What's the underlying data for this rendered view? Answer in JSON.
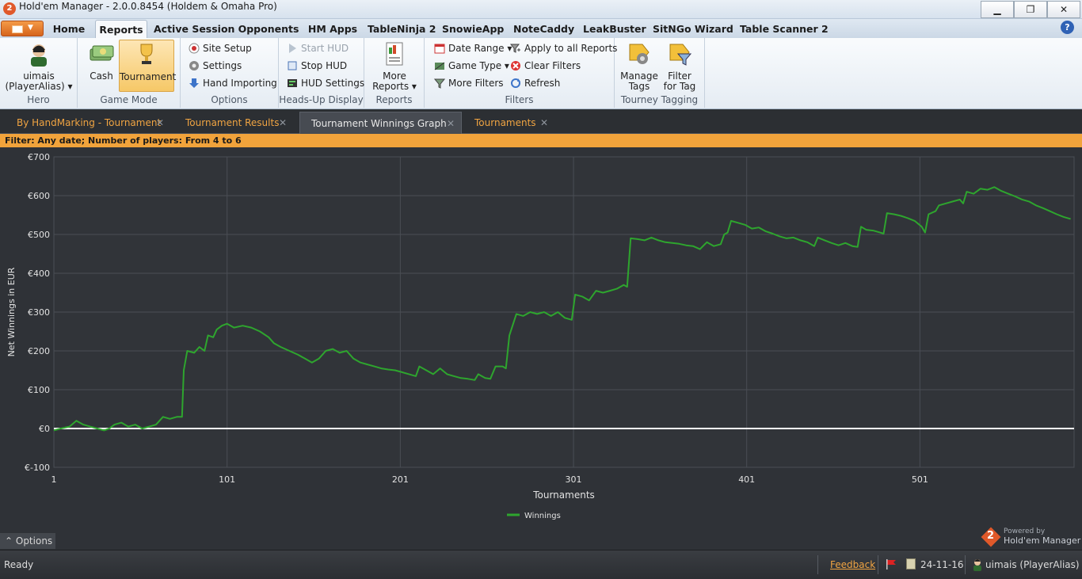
{
  "window": {
    "title": "Hold'em Manager - 2.0.0.8454 (Holdem & Omaha Pro)",
    "app_icon_text": "2",
    "minimize": "▁",
    "restore": "❐",
    "close": "✕"
  },
  "ribbon_tabs": [
    {
      "label": "Home"
    },
    {
      "label": "Reports"
    },
    {
      "label": "Active Session"
    },
    {
      "label": "Opponents"
    },
    {
      "label": "HM Apps"
    },
    {
      "label": "TableNinja 2"
    },
    {
      "label": "SnowieApp"
    },
    {
      "label": "NoteCaddy"
    },
    {
      "label": "LeakBuster"
    },
    {
      "label": "SitNGo Wizard"
    },
    {
      "label": "Table Scanner 2"
    }
  ],
  "help": "?",
  "ribbon": {
    "hero": {
      "label_line1": "uimais",
      "label_line2": "(PlayerAlias) ▾",
      "group": "Hero"
    },
    "game_mode": {
      "cash": "Cash",
      "tournament": "Tournament",
      "group": "Game Mode"
    },
    "options": {
      "site_setup": "Site Setup",
      "settings": "Settings",
      "hand_importing": "Hand Importing",
      "group": "Options"
    },
    "hud": {
      "start_hud": "Start HUD",
      "stop_hud": "Stop HUD",
      "hud_settings": "HUD Settings",
      "group": "Heads-Up Display"
    },
    "reports": {
      "more_line1": "More",
      "more_line2": "Reports ▾",
      "group": "Reports"
    },
    "filters": {
      "date_range": "Date Range ▾",
      "game_type": "Game Type ▾",
      "more_filters": "More Filters",
      "apply_all": "Apply to all Reports",
      "clear_filters": "Clear Filters",
      "refresh": "Refresh",
      "group": "Filters"
    },
    "tagging": {
      "manage_line1": "Manage",
      "manage_line2": "Tags",
      "filter_line1": "Filter",
      "filter_line2": "for Tag",
      "group": "Tourney Tagging"
    }
  },
  "doc_tabs": [
    {
      "label": "By HandMarking - Tournament"
    },
    {
      "label": "Tournament Results"
    },
    {
      "label": "Tournament Winnings Graph"
    },
    {
      "label": "Tournaments"
    }
  ],
  "tab_close": "✕",
  "filter_text": "Filter: Any date; Number of players: From 4 to 6",
  "colors": {
    "line": "#2ea52e",
    "zero_line": "#ffffff",
    "grid": "#4a4e55",
    "axis_text": "#e2e2e2",
    "accent": "#f1a33b"
  },
  "chart_data": {
    "type": "line",
    "ylabel": "Net Winnings in EUR",
    "xlabel": "Tournaments",
    "ylim": [
      -100,
      700
    ],
    "xlim": [
      1,
      590
    ],
    "y_ticks": [
      "€-100",
      "€0",
      "€100",
      "€200",
      "€300",
      "€400",
      "€500",
      "€600",
      "€700"
    ],
    "x_ticks": [
      "1",
      "101",
      "201",
      "301",
      "401",
      "501"
    ],
    "grid": true,
    "legend": "bottom-center",
    "series": [
      {
        "name": "Winnings",
        "points": [
          [
            1,
            -5
          ],
          [
            5,
            0
          ],
          [
            10,
            5
          ],
          [
            14,
            20
          ],
          [
            18,
            10
          ],
          [
            22,
            5
          ],
          [
            26,
            0
          ],
          [
            30,
            -5
          ],
          [
            33,
            0
          ],
          [
            36,
            10
          ],
          [
            40,
            15
          ],
          [
            44,
            5
          ],
          [
            48,
            10
          ],
          [
            52,
            0
          ],
          [
            56,
            5
          ],
          [
            60,
            10
          ],
          [
            64,
            30
          ],
          [
            68,
            25
          ],
          [
            72,
            30
          ],
          [
            75,
            30
          ],
          [
            76,
            150
          ],
          [
            78,
            200
          ],
          [
            82,
            195
          ],
          [
            85,
            210
          ],
          [
            88,
            200
          ],
          [
            90,
            240
          ],
          [
            93,
            235
          ],
          [
            95,
            255
          ],
          [
            98,
            265
          ],
          [
            101,
            270
          ],
          [
            105,
            260
          ],
          [
            110,
            265
          ],
          [
            115,
            260
          ],
          [
            120,
            250
          ],
          [
            125,
            235
          ],
          [
            128,
            220
          ],
          [
            132,
            210
          ],
          [
            137,
            200
          ],
          [
            142,
            190
          ],
          [
            146,
            180
          ],
          [
            150,
            170
          ],
          [
            154,
            180
          ],
          [
            158,
            200
          ],
          [
            162,
            205
          ],
          [
            166,
            195
          ],
          [
            170,
            200
          ],
          [
            174,
            180
          ],
          [
            178,
            170
          ],
          [
            182,
            165
          ],
          [
            186,
            160
          ],
          [
            190,
            155
          ],
          [
            194,
            152
          ],
          [
            198,
            150
          ],
          [
            202,
            145
          ],
          [
            206,
            140
          ],
          [
            210,
            135
          ],
          [
            212,
            160
          ],
          [
            216,
            150
          ],
          [
            220,
            140
          ],
          [
            224,
            155
          ],
          [
            228,
            140
          ],
          [
            232,
            135
          ],
          [
            236,
            130
          ],
          [
            240,
            128
          ],
          [
            244,
            125
          ],
          [
            246,
            140
          ],
          [
            250,
            130
          ],
          [
            253,
            128
          ],
          [
            256,
            160
          ],
          [
            260,
            160
          ],
          [
            262,
            155
          ],
          [
            264,
            240
          ],
          [
            268,
            295
          ],
          [
            272,
            290
          ],
          [
            276,
            300
          ],
          [
            280,
            295
          ],
          [
            284,
            300
          ],
          [
            288,
            290
          ],
          [
            292,
            300
          ],
          [
            296,
            285
          ],
          [
            300,
            280
          ],
          [
            302,
            345
          ],
          [
            306,
            340
          ],
          [
            310,
            330
          ],
          [
            314,
            355
          ],
          [
            318,
            350
          ],
          [
            322,
            355
          ],
          [
            326,
            360
          ],
          [
            330,
            370
          ],
          [
            332,
            365
          ],
          [
            334,
            490
          ],
          [
            338,
            488
          ],
          [
            342,
            485
          ],
          [
            346,
            492
          ],
          [
            350,
            485
          ],
          [
            354,
            480
          ],
          [
            358,
            478
          ],
          [
            362,
            476
          ],
          [
            366,
            472
          ],
          [
            370,
            470
          ],
          [
            374,
            462
          ],
          [
            378,
            480
          ],
          [
            382,
            470
          ],
          [
            386,
            475
          ],
          [
            388,
            500
          ],
          [
            390,
            505
          ],
          [
            392,
            535
          ],
          [
            396,
            530
          ],
          [
            400,
            525
          ],
          [
            404,
            515
          ],
          [
            408,
            518
          ],
          [
            412,
            508
          ],
          [
            416,
            502
          ],
          [
            420,
            495
          ],
          [
            424,
            490
          ],
          [
            428,
            492
          ],
          [
            432,
            485
          ],
          [
            436,
            480
          ],
          [
            440,
            470
          ],
          [
            442,
            492
          ],
          [
            446,
            485
          ],
          [
            450,
            478
          ],
          [
            454,
            472
          ],
          [
            458,
            478
          ],
          [
            462,
            470
          ],
          [
            465,
            468
          ],
          [
            467,
            520
          ],
          [
            470,
            512
          ],
          [
            474,
            510
          ],
          [
            478,
            505
          ],
          [
            480,
            502
          ],
          [
            482,
            555
          ],
          [
            486,
            552
          ],
          [
            490,
            548
          ],
          [
            494,
            542
          ],
          [
            498,
            535
          ],
          [
            502,
            520
          ],
          [
            504,
            505
          ],
          [
            506,
            552
          ],
          [
            510,
            560
          ],
          [
            512,
            575
          ],
          [
            516,
            580
          ],
          [
            520,
            585
          ],
          [
            524,
            590
          ],
          [
            526,
            580
          ],
          [
            528,
            610
          ],
          [
            532,
            605
          ],
          [
            536,
            618
          ],
          [
            540,
            615
          ],
          [
            544,
            622
          ],
          [
            548,
            612
          ],
          [
            552,
            605
          ],
          [
            556,
            598
          ],
          [
            560,
            590
          ],
          [
            564,
            585
          ],
          [
            568,
            575
          ],
          [
            572,
            568
          ],
          [
            576,
            560
          ],
          [
            580,
            552
          ],
          [
            584,
            545
          ],
          [
            588,
            540
          ]
        ]
      }
    ]
  },
  "options_label": "⌃  Options",
  "powered": {
    "small": "Powered by",
    "big": "Hold'em Manager",
    "num": "2"
  },
  "status": {
    "text": "Ready",
    "feedback": "Feedback",
    "date": "24-11-16",
    "user": "uimais (PlayerAlias)"
  }
}
